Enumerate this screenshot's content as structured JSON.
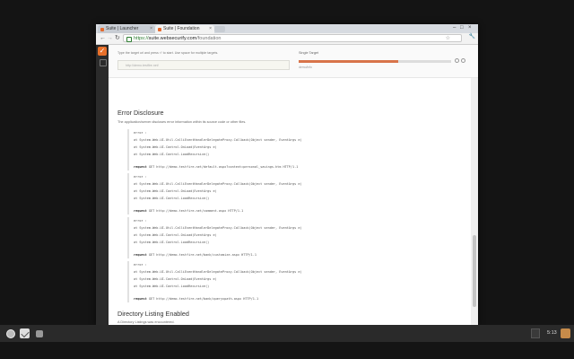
{
  "browser": {
    "tabs": [
      {
        "label": "Suite | Launcher",
        "active": false
      },
      {
        "label": "Suite | Foundation",
        "active": true
      }
    ],
    "url": {
      "scheme": "https://",
      "host": "suite.websecurify.com",
      "path": "/foundation"
    }
  },
  "app": {
    "logo": "✓",
    "target_hint": "Type the target url and press ⏎ to start. Use space for multiple targets.",
    "target_placeholder": "http://demo.testfire.net/",
    "single_target_label": "Single Target",
    "progress_sub": "demo/info",
    "progress": 0.65
  },
  "sections": [
    {
      "title": "Error Disclosure",
      "description": "The application/server discloses error information within its source code or other files."
    },
    {
      "title": "Directory Listing Enabled",
      "description": "A Directory Listings was encountered."
    }
  ],
  "errors": [
    {
      "lines": [
        "error :",
        "at System.Web.UI.Util.CalliEventHandlerDelegateProxy.Callback(Object sender, EventArgs e)",
        "at System.Web.UI.Control.OnLoad(EventArgs e)",
        "at System.Web.UI.Control.LoadRecursive()"
      ],
      "request_label": "request",
      "request": "GET http://demo.testfire.net/default.aspx?content=personal_savings.htm HTTP/1.1"
    },
    {
      "lines": [
        "error :",
        "at System.Web.UI.Util.CalliEventHandlerDelegateProxy.Callback(Object sender, EventArgs e)",
        "at System.Web.UI.Control.OnLoad(EventArgs e)",
        "at System.Web.UI.Control.LoadRecursive()"
      ],
      "request_label": "request",
      "request": "GET http://demo.testfire.net/comment.aspx HTTP/1.1"
    },
    {
      "lines": [
        "error :",
        "at System.Web.UI.Util.CalliEventHandlerDelegateProxy.Callback(Object sender, EventArgs e)",
        "at System.Web.UI.Control.OnLoad(EventArgs e)",
        "at System.Web.UI.Control.LoadRecursive()"
      ],
      "request_label": "request",
      "request": "GET http://demo.testfire.net/bank/customize.aspx HTTP/1.1"
    },
    {
      "lines": [
        "error :",
        "at System.Web.UI.Util.CalliEventHandlerDelegateProxy.Callback(Object sender, EventArgs e)",
        "at System.Web.UI.Control.OnLoad(EventArgs e)",
        "at System.Web.UI.Control.LoadRecursive()"
      ],
      "request_label": "request",
      "request": "GET http://demo.testfire.net/bank/queryxpath.aspx HTTP/1.1"
    }
  ],
  "shelf": {
    "clock": "5:13"
  },
  "colors": {
    "accent": "#e8702a",
    "progress": "#d8744a"
  }
}
